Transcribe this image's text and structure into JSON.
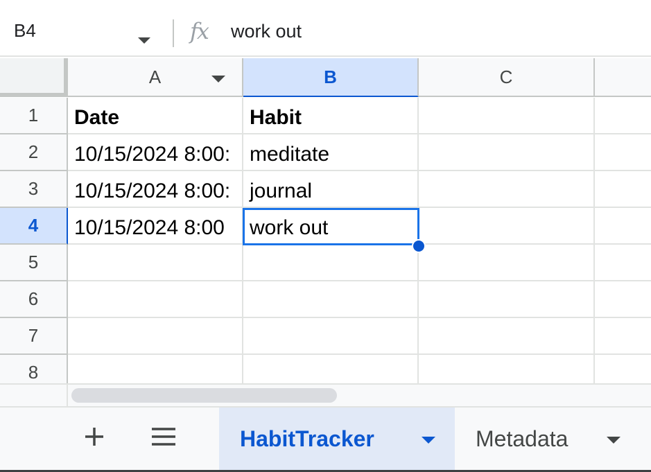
{
  "formula_bar": {
    "name_box": "B4",
    "fx_label": "fx",
    "formula": "work out"
  },
  "columns": [
    {
      "label": "A",
      "selected": false
    },
    {
      "label": "B",
      "selected": true
    },
    {
      "label": "C",
      "selected": false
    }
  ],
  "rows": [
    {
      "num": "1",
      "a": "Date",
      "b": "Habit",
      "c": ""
    },
    {
      "num": "2",
      "a": "10/15/2024 8:00:",
      "b": "meditate",
      "c": ""
    },
    {
      "num": "3",
      "a": "10/15/2024 8:00:",
      "b": "journal",
      "c": ""
    },
    {
      "num": "4",
      "a": "10/15/2024 8:00",
      "b": "work out",
      "c": ""
    },
    {
      "num": "5",
      "a": "",
      "b": "",
      "c": ""
    },
    {
      "num": "6",
      "a": "",
      "b": "",
      "c": ""
    },
    {
      "num": "7",
      "a": "",
      "b": "",
      "c": ""
    },
    {
      "num": "8",
      "a": "",
      "b": "",
      "c": ""
    }
  ],
  "selection": {
    "cell": "B4"
  },
  "toolbar": {
    "add_sheet_icon": "plus-icon",
    "all_sheets_icon": "menu-icon"
  },
  "sheets": [
    {
      "name": "HabitTracker",
      "active": true
    },
    {
      "name": "Metadata",
      "active": false
    }
  ],
  "colors": {
    "accent": "#0b57d0",
    "selection_border": "#1a73e8",
    "active_tab_bg": "#e1e9f7"
  }
}
